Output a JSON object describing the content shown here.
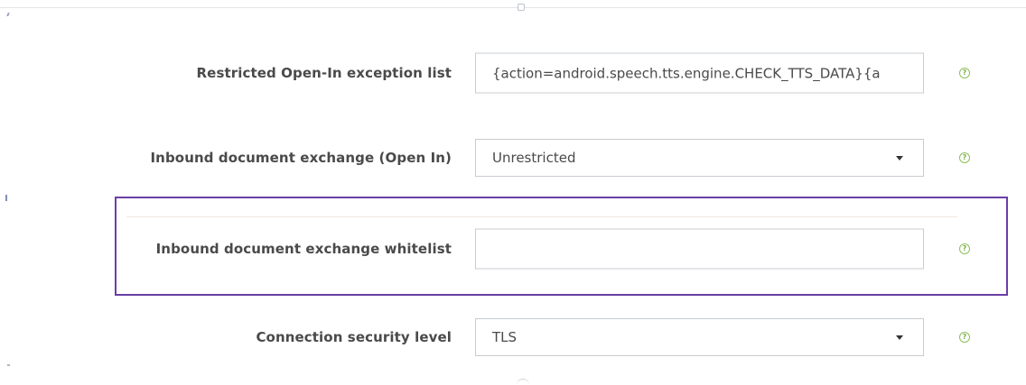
{
  "settings": {
    "rows": [
      {
        "label": "Restricted Open-In exception list",
        "value": "{action=android.speech.tts.engine.CHECK_TTS_DATA}{a",
        "control": "text",
        "help_icon": "question-circle-icon"
      },
      {
        "label": "Inbound document exchange (Open In)",
        "value": "Unrestricted",
        "control": "select",
        "help_icon": "question-circle-icon"
      },
      {
        "label": "Inbound document exchange whitelist",
        "value": "",
        "control": "text",
        "highlighted": true,
        "help_icon": "question-circle-icon"
      },
      {
        "label": "Connection security level",
        "value": "TLS",
        "control": "select",
        "help_icon": "question-circle-icon"
      }
    ],
    "help_glyph": "?"
  },
  "colors": {
    "highlight_border": "#6a3fa4",
    "help_icon": "#7aae45",
    "input_border": "#c8ccd0",
    "label_text": "#4a4a4a"
  }
}
